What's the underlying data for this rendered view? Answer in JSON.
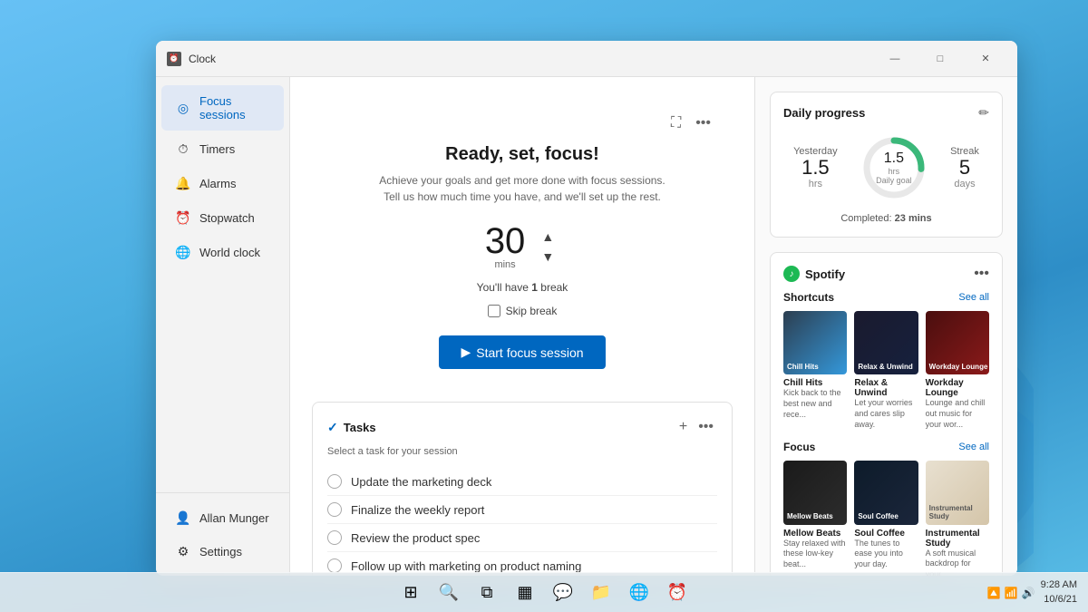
{
  "window": {
    "title": "Clock",
    "controls": {
      "minimize": "—",
      "maximize": "□",
      "close": "✕"
    }
  },
  "sidebar": {
    "items": [
      {
        "id": "focus-sessions",
        "label": "Focus sessions",
        "icon": "◎",
        "active": true
      },
      {
        "id": "timers",
        "label": "Timers",
        "icon": "⏱"
      },
      {
        "id": "alarms",
        "label": "Alarms",
        "icon": "🔔"
      },
      {
        "id": "stopwatch",
        "label": "Stopwatch",
        "icon": "⏰"
      },
      {
        "id": "world-clock",
        "label": "World clock",
        "icon": "🌐"
      }
    ],
    "bottom": {
      "user": "Allan Munger",
      "settings": "Settings"
    }
  },
  "focus": {
    "title": "Ready, set, focus!",
    "subtitle_line1": "Achieve your goals and get more done with focus sessions.",
    "subtitle_line2": "Tell us how much time you have, and we'll set up the rest.",
    "time_value": "30",
    "time_unit": "mins",
    "break_text": "You'll have",
    "break_count": "1",
    "break_word": "break",
    "skip_label": "Skip break",
    "start_button": "Start focus session"
  },
  "tasks": {
    "title": "Tasks",
    "subtitle": "Select a task for your session",
    "items": [
      {
        "id": 1,
        "text": "Update the marketing deck"
      },
      {
        "id": 2,
        "text": "Finalize the weekly report"
      },
      {
        "id": 3,
        "text": "Review the product spec"
      },
      {
        "id": 4,
        "text": "Follow up with marketing on product naming"
      }
    ]
  },
  "daily_progress": {
    "title": "Daily progress",
    "yesterday_label": "Yesterday",
    "yesterday_value": "1.5",
    "yesterday_unit": "hrs",
    "daily_goal_label": "Daily goal",
    "daily_goal_value": "1.5",
    "daily_goal_unit": "hrs",
    "streak_label": "Streak",
    "streak_value": "5",
    "streak_unit": "days",
    "completed_label": "Completed:",
    "completed_value": "23 mins"
  },
  "spotify": {
    "title": "Spotify",
    "shortcuts_label": "Shortcuts",
    "see_all_shortcuts": "See all",
    "focus_label": "Focus",
    "see_all_focus": "See all",
    "shortcuts": [
      {
        "name": "Chill Hits",
        "desc": "Kick back to the best new and rece...",
        "thumb_class": "thumb-chill",
        "thumb_text": "Chill Hits"
      },
      {
        "name": "Relax & Unwind",
        "desc": "Let your worries and cares slip away.",
        "thumb_class": "thumb-relax",
        "thumb_text": "Relax & Unwind"
      },
      {
        "name": "Workday Lounge",
        "desc": "Lounge and chill out music for your wor...",
        "thumb_class": "thumb-workday",
        "thumb_text": "Workday Lounge"
      }
    ],
    "focus_items": [
      {
        "name": "Mellow Beats",
        "desc": "Stay relaxed with these low-key beat...",
        "thumb_class": "thumb-mellow",
        "thumb_text": "Mellow Beats"
      },
      {
        "name": "Soul Coffee",
        "desc": "The tunes to ease you into your day.",
        "thumb_class": "thumb-soul",
        "thumb_text": "Soul Coffee"
      },
      {
        "name": "Instrumental Study",
        "desc": "A soft musical backdrop for your...",
        "thumb_class": "thumb-instrumental",
        "thumb_text": "Instrumental Study"
      }
    ]
  },
  "taskbar": {
    "icons": [
      {
        "id": "start",
        "symbol": "⊞"
      },
      {
        "id": "search",
        "symbol": "🔍"
      },
      {
        "id": "task-view",
        "symbol": "⧉"
      },
      {
        "id": "widgets",
        "symbol": "▦"
      },
      {
        "id": "teams",
        "symbol": "💬"
      },
      {
        "id": "explorer",
        "symbol": "📁"
      },
      {
        "id": "edge",
        "symbol": "🌐"
      },
      {
        "id": "clock-app",
        "symbol": "⏰"
      }
    ],
    "sys_icons": [
      "🔼",
      "📶",
      "🔊"
    ],
    "date": "10/6/21",
    "time": "9:28 AM"
  }
}
